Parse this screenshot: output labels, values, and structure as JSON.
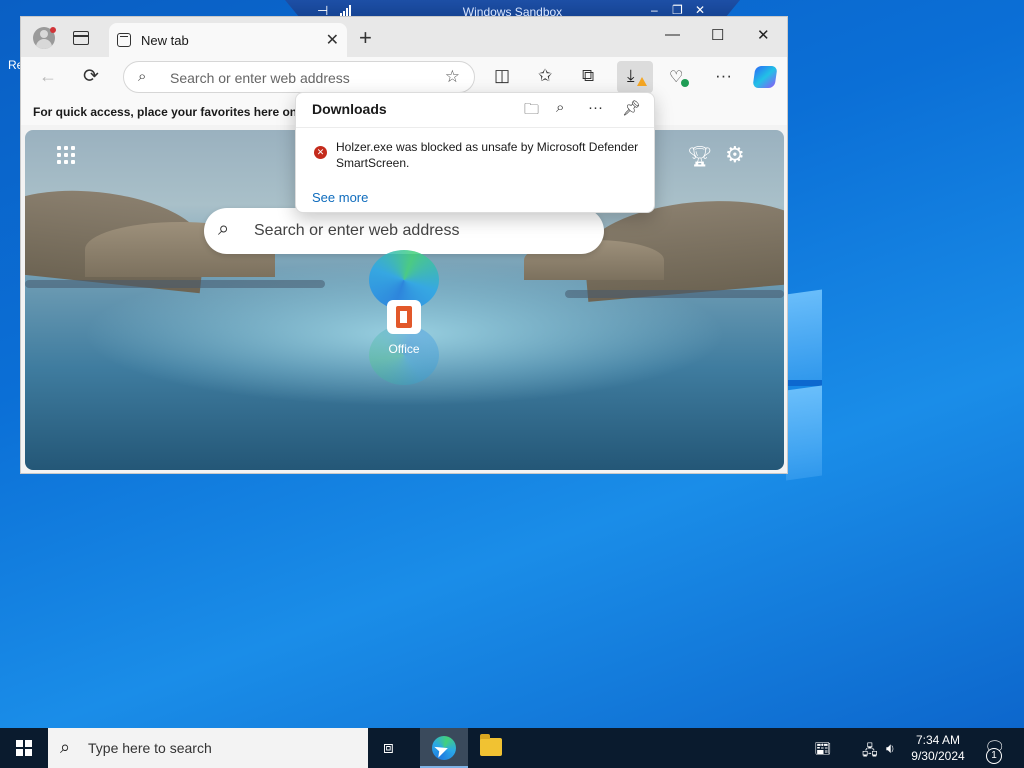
{
  "desktop": {
    "partial_label": "Re"
  },
  "sandbox": {
    "title": "Windows Sandbox",
    "pin_glyph": "⊣",
    "minimize": "–",
    "restore": "❐",
    "close": "✕"
  },
  "browser": {
    "tab": {
      "label": "New tab",
      "close": "✕"
    },
    "new_tab": "+",
    "window_controls": {
      "minimize": "—",
      "maximize": "☐",
      "close": "✕"
    },
    "toolbar": {
      "back": "←",
      "reload": "⟳",
      "address_placeholder": "Search or enter web address",
      "star": "☆",
      "more": "···"
    },
    "favorites_bar": {
      "message": "For quick access, place your favorites here on th"
    }
  },
  "new_tab_page": {
    "search_placeholder": "Search or enter web address",
    "quick_link": {
      "label": "Office"
    }
  },
  "downloads": {
    "title": "Downloads",
    "more_glyph": "···",
    "items": [
      {
        "message": "Holzer.exe was blocked as unsafe by Microsoft Defender SmartScreen.",
        "status": "blocked"
      }
    ],
    "see_more": "See more"
  },
  "taskbar": {
    "search_placeholder": "Type here to search",
    "clock": {
      "time": "7:34 AM",
      "date": "9/30/2024"
    },
    "notification_count": "1"
  },
  "colors": {
    "desktop_blue": "#0b6fd6",
    "error_red": "#c42b1c",
    "link_blue": "#0f6cbd",
    "warning_orange": "#f5a623",
    "taskbar": "#0a1b2e"
  },
  "icons": [
    "profile-icon",
    "tab-actions-icon",
    "favicon-icon",
    "search-icon",
    "favorites-star-icon",
    "split-screen-icon",
    "favorites-icon",
    "collections-icon",
    "download-icon",
    "browser-essentials-icon",
    "more-icon",
    "copilot-icon",
    "apps-grid-icon",
    "rewards-trophy-icon",
    "settings-gear-icon",
    "folder-icon",
    "pin-icon",
    "error-icon",
    "windows-start-icon",
    "task-view-icon",
    "edge-icon",
    "file-explorer-icon",
    "news-icon",
    "network-icon",
    "volume-icon",
    "notification-icon"
  ]
}
